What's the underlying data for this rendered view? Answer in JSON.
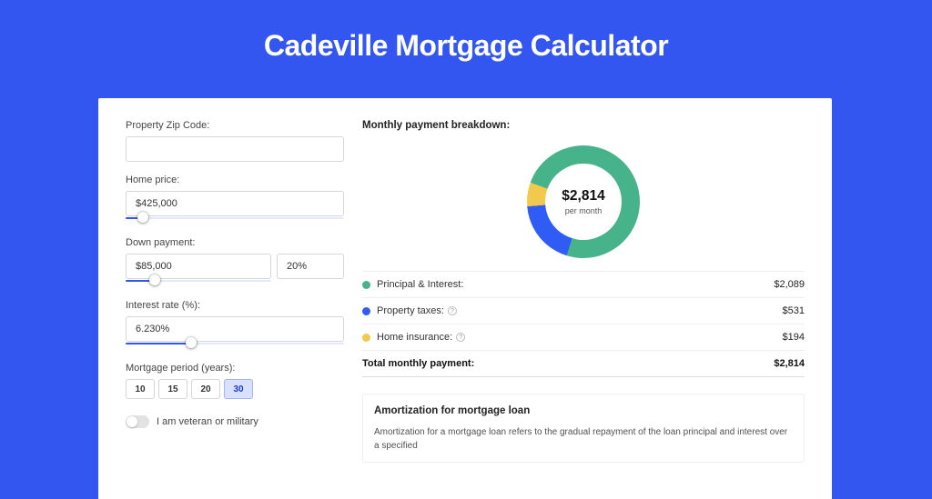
{
  "title": "Cadeville Mortgage Calculator",
  "form": {
    "zip": {
      "label": "Property Zip Code:",
      "value": ""
    },
    "price": {
      "label": "Home price:",
      "value": "$425,000",
      "slider_pct": 8
    },
    "down": {
      "label": "Down payment:",
      "value": "$85,000",
      "pct": "20%",
      "slider_pct": 20
    },
    "rate": {
      "label": "Interest rate (%):",
      "value": "6.230%",
      "slider_pct": 30
    },
    "period": {
      "label": "Mortgage period (years):",
      "options": [
        "10",
        "15",
        "20",
        "30"
      ],
      "selected": "30"
    },
    "veteran": {
      "label": "I am veteran or military",
      "on": false
    }
  },
  "breakdown": {
    "title": "Monthly payment breakdown:",
    "donut": {
      "amount": "$2,814",
      "sub": "per month"
    },
    "items": [
      {
        "label": "Principal & Interest:",
        "value": "$2,089",
        "color": "#46b38a",
        "info": false
      },
      {
        "label": "Property taxes:",
        "value": "$531",
        "color": "#2e5cf4",
        "info": true
      },
      {
        "label": "Home insurance:",
        "value": "$194",
        "color": "#f2c94c",
        "info": true
      }
    ],
    "total_label": "Total monthly payment:",
    "total_value": "$2,814"
  },
  "amort": {
    "title": "Amortization for mortgage loan",
    "body": "Amortization for a mortgage loan refers to the gradual repayment of the loan principal and interest over a specified"
  },
  "colors": {
    "green": "#46b38a",
    "blue": "#2e5cf4",
    "yellow": "#f2c94c"
  },
  "chart_data": {
    "type": "pie",
    "title": "Monthly payment breakdown",
    "series": [
      {
        "name": "Principal & Interest",
        "value": 2089,
        "color": "#46b38a"
      },
      {
        "name": "Property taxes",
        "value": 531,
        "color": "#2e5cf4"
      },
      {
        "name": "Home insurance",
        "value": 194,
        "color": "#f2c94c"
      }
    ],
    "total": 2814,
    "center_label": "$2,814 per month"
  }
}
